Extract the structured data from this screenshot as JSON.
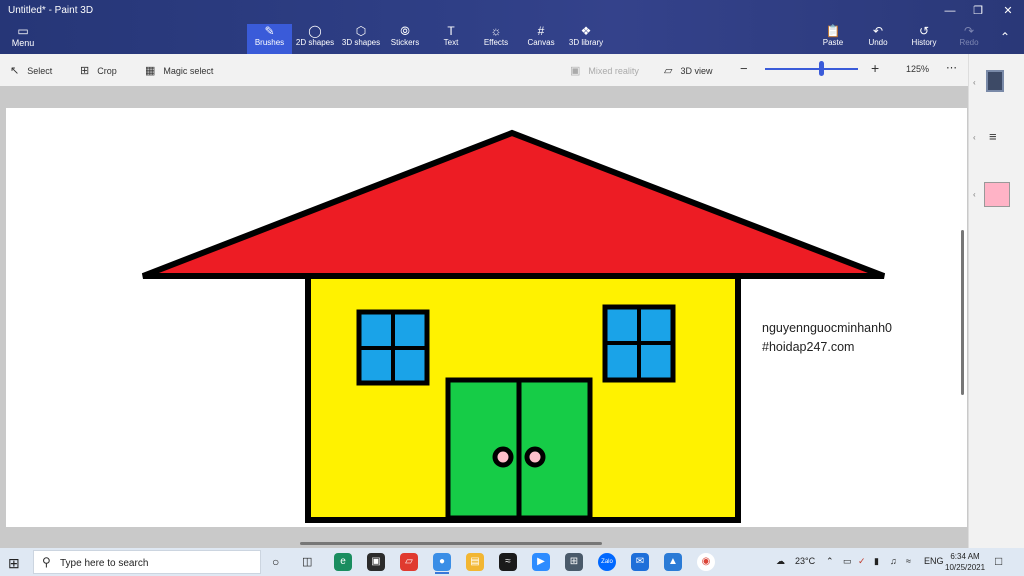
{
  "window": {
    "title": "Untitled* - Paint 3D",
    "minimize_icon": "minimize-icon",
    "maximize_icon": "maximize-icon",
    "close_icon": "close-icon"
  },
  "ribbon": {
    "menu_label": "Menu",
    "tools": [
      {
        "label": "Brushes",
        "icon": "brush-icon",
        "active": true
      },
      {
        "label": "2D shapes",
        "icon": "2d-shapes-icon"
      },
      {
        "label": "3D shapes",
        "icon": "3d-shapes-icon"
      },
      {
        "label": "Stickers",
        "icon": "sticker-icon"
      },
      {
        "label": "Text",
        "icon": "text-icon"
      },
      {
        "label": "Effects",
        "icon": "effects-icon"
      },
      {
        "label": "Canvas",
        "icon": "canvas-icon"
      },
      {
        "label": "3D library",
        "icon": "3d-library-icon"
      }
    ],
    "right": [
      {
        "label": "Paste",
        "icon": "paste-icon"
      },
      {
        "label": "Undo",
        "icon": "undo-icon"
      },
      {
        "label": "History",
        "icon": "history-icon"
      },
      {
        "label": "Redo",
        "icon": "redo-icon",
        "disabled": true
      }
    ]
  },
  "subtoolbar": {
    "select": "Select",
    "crop": "Crop",
    "magic_select": "Magic select",
    "mixed_reality": "Mixed reality",
    "view_3d": "3D view",
    "zoom": "125%",
    "zoom_level": 0.6
  },
  "canvas": {
    "watermark_line1": "nguyennguocminhanh0",
    "watermark_line2": "#hoidap247.com",
    "colors": {
      "roof": "#ed1c24",
      "wall": "#fff200",
      "window": "#1aa3e8",
      "door": "#16cc47",
      "knob": "#ffc0cb",
      "outline": "#000000"
    }
  },
  "right_panel": {
    "swatch_color": "#ffb3c6"
  },
  "taskbar": {
    "search_placeholder": "Type here to search",
    "weather": "23°C",
    "language": "ENG",
    "time": "6:34 AM",
    "date": "10/25/2021"
  }
}
